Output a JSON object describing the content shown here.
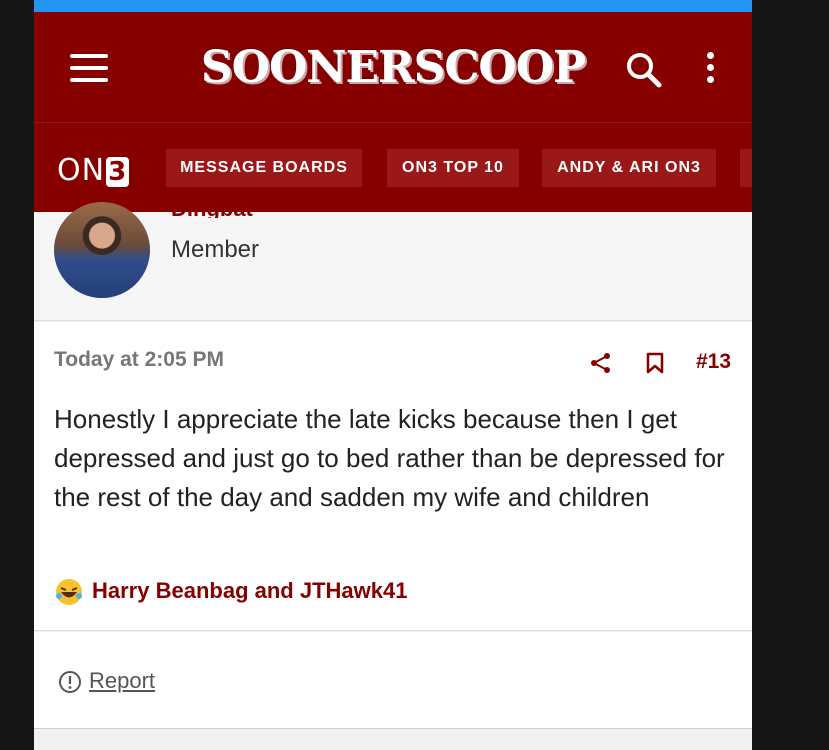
{
  "header": {
    "site_logo": "SOONERSCOOP",
    "menu_icon": "hamburger-menu-icon",
    "search_icon": "search-icon",
    "more_icon": "vertical-dots-icon",
    "brand_color": "#870000",
    "status_bar_color": "#2196f3"
  },
  "nav": {
    "logo_text": "ON",
    "logo_digit": "3",
    "tabs": [
      {
        "label": "MESSAGE BOARDS"
      },
      {
        "label": "ON3 TOP 10"
      },
      {
        "label": "ANDY & ARI ON3"
      }
    ]
  },
  "author": {
    "name": "Dingbat",
    "title": "Member"
  },
  "post": {
    "timestamp": "Today at 2:05 PM",
    "number": "#13",
    "body": "Honestly I appreciate the late kicks because then I get depressed and just go to bed rather than be depressed for the rest of the day and sadden my wife and children",
    "reactions": {
      "icon": "laughing-emoji-icon",
      "names": "Harry Beanbag and JTHawk41"
    }
  },
  "footer": {
    "report_label": "Report"
  }
}
